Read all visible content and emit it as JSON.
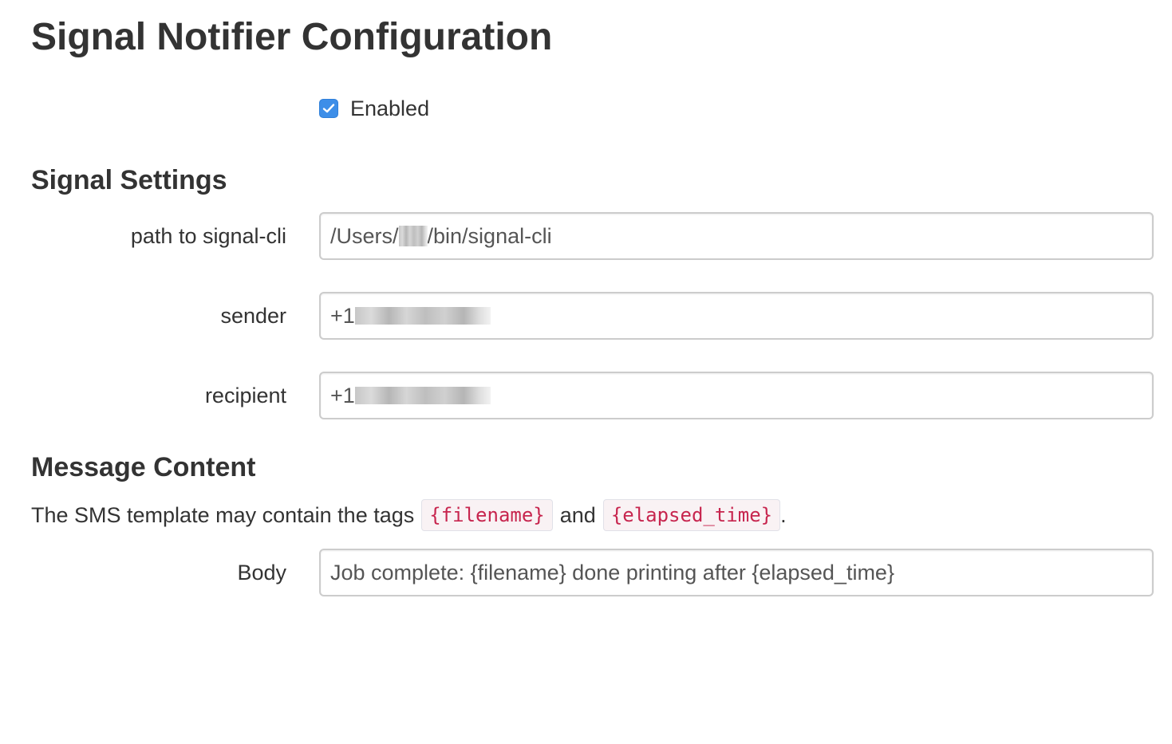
{
  "page_title": "Signal Notifier Configuration",
  "enabled": {
    "checked": true,
    "label": "Enabled",
    "accent_color": "#3d8ee8"
  },
  "signal_settings": {
    "heading": "Signal Settings",
    "path": {
      "label": "path to signal-cli",
      "value_prefix": "/Users/",
      "value_suffix": "/bin/signal-cli"
    },
    "sender": {
      "label": "sender",
      "value_prefix": "+1"
    },
    "recipient": {
      "label": "recipient",
      "value_prefix": "+1"
    }
  },
  "message_content": {
    "heading": "Message Content",
    "intro_before": "The SMS template may contain the tags",
    "tag_filename": "{filename}",
    "intro_and": "and",
    "tag_elapsed": "{elapsed_time}",
    "intro_after": ".",
    "tag_color": "#c7254e",
    "body": {
      "label": "Body",
      "value": "Job complete: {filename} done printing after {elapsed_time}"
    }
  }
}
